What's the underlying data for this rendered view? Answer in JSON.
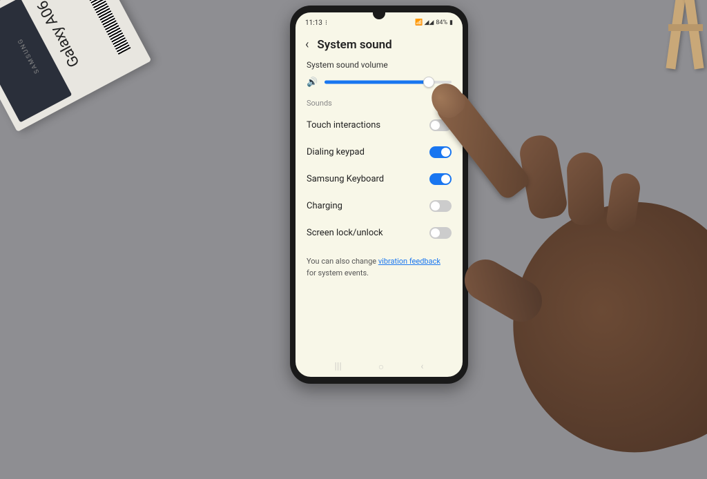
{
  "product_box": {
    "brand": "Galaxy A06",
    "samsung": "SAMSUNG"
  },
  "status_bar": {
    "time": "11:13",
    "battery_pct": "84%"
  },
  "header": {
    "title": "System sound"
  },
  "volume": {
    "label": "System sound volume",
    "value_pct": 82
  },
  "sections": {
    "sounds_header": "Sounds"
  },
  "settings": [
    {
      "label": "Touch interactions",
      "on": false
    },
    {
      "label": "Dialing keypad",
      "on": true
    },
    {
      "label": "Samsung Keyboard",
      "on": true
    },
    {
      "label": "Charging",
      "on": false
    },
    {
      "label": "Screen lock/unlock",
      "on": false
    }
  ],
  "footer": {
    "prefix": "You can also change ",
    "link": "vibration feedback",
    "suffix": " for system events."
  }
}
